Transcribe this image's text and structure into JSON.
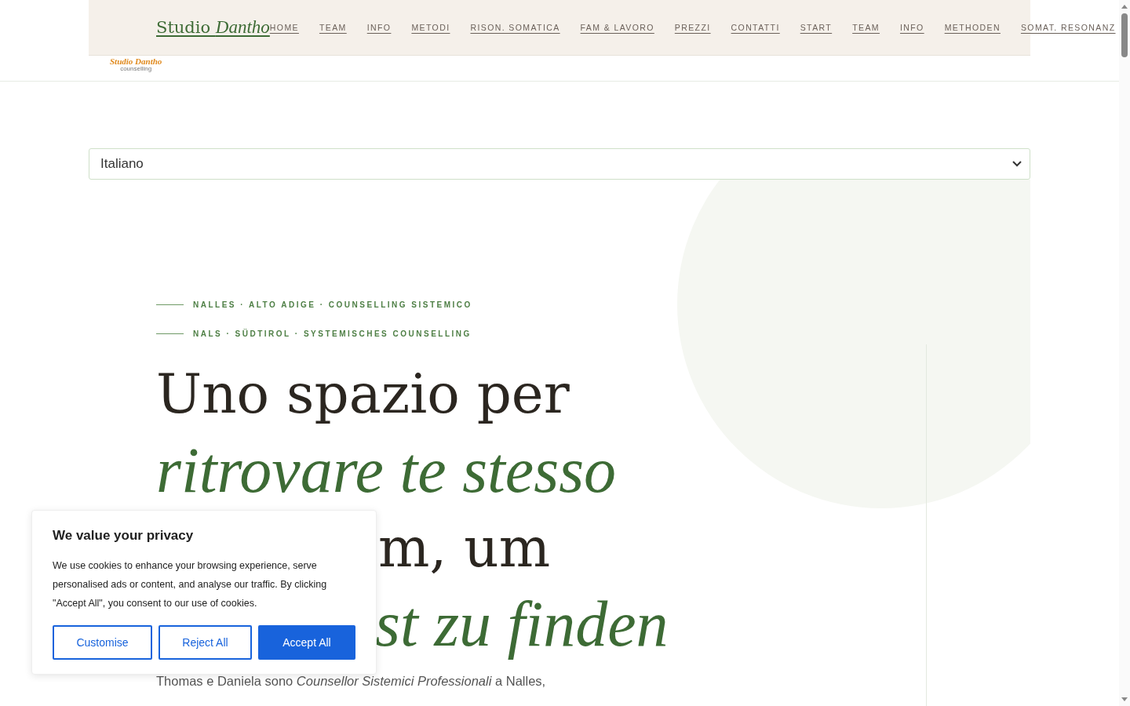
{
  "header": {
    "logo": {
      "title": "Studio Dantho",
      "subtitle": "counselling"
    }
  },
  "sticky_nav": {
    "brand": {
      "plain": "Studio",
      "italic": "Dantho"
    },
    "links": [
      "HOME",
      "TEAM",
      "INFO",
      "METODI",
      "RISON. SOMATICA",
      "FAM & LAVORO",
      "PREZZI",
      "CONTATTI",
      "START",
      "TEAM",
      "INFO",
      "METHODEN",
      "SOMAT. RESONANZ"
    ]
  },
  "language_select": {
    "value": "Italiano"
  },
  "hero": {
    "eyebrows": [
      "NALLES · ALTO ADIGE · COUNSELLING SISTEMICO",
      "NALS · SÜDTIROL · SYSTEMISCHES COUNSELLING"
    ],
    "headline": [
      {
        "text": "Uno spazio per",
        "kind": "plain"
      },
      {
        "text": "ritrovare te stesso",
        "kind": "accent"
      },
      {
        "text": "m, um",
        "kind": "plain-partial"
      },
      {
        "text": "st zu finden",
        "kind": "accent-partial"
      }
    ],
    "intro": "Thomas e Daniela sono *Counsellor Sistemici Professionali* a Nalles,"
  },
  "cookie_banner": {
    "title": "We value your privacy",
    "text": "We use cookies to enhance your browsing experience, serve personalised ads or content, and analyse our traffic. By clicking \"Accept All\", you consent to our use of cookies.",
    "buttons": [
      {
        "label": "Customise",
        "kind": "outline"
      },
      {
        "label": "Reject All",
        "kind": "outline"
      },
      {
        "label": "Accept All",
        "kind": "primary"
      }
    ]
  }
}
